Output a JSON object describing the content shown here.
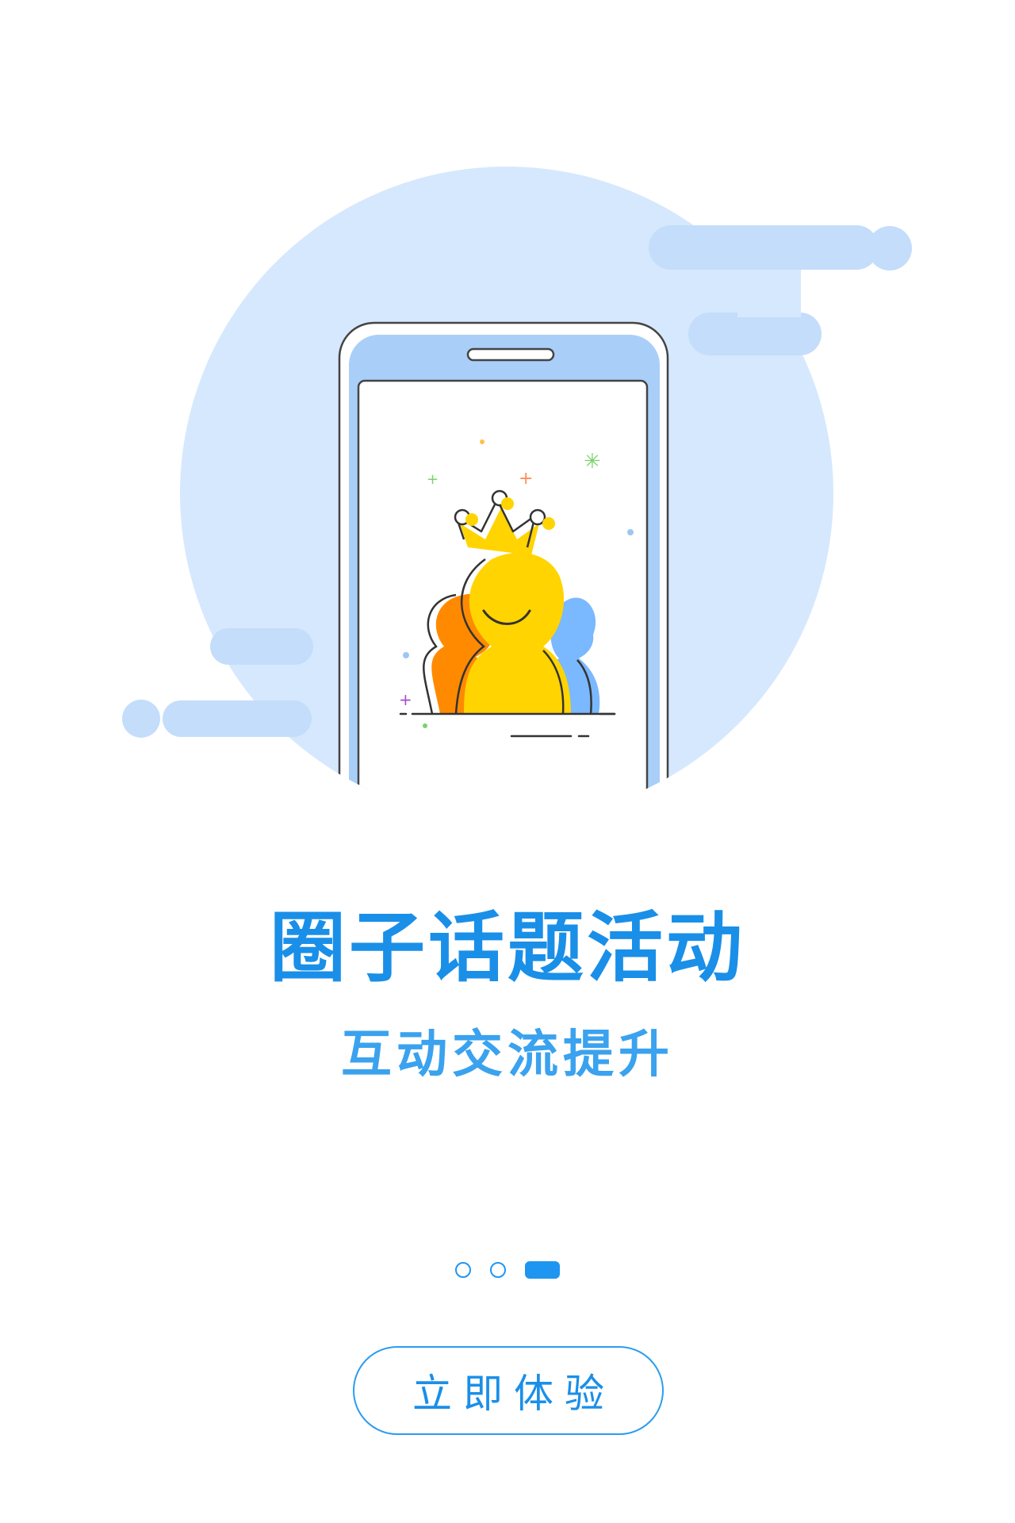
{
  "illustration": {
    "icon": "phone-with-crowned-people-icon"
  },
  "intro": {
    "title": "圈子话题活动",
    "subtitle": "互动交流提升"
  },
  "pager": {
    "total_pages": 3,
    "active_page": 3
  },
  "cta": {
    "label": "立即体验"
  },
  "colors": {
    "accent": "#1a8fe8",
    "circle_bg": "#d6e8fd",
    "cloud": "#c3ddfb",
    "crown_yellow": "#ffd400",
    "left_person_orange": "#ff8a00",
    "right_person_blue": "#7ab8ff"
  }
}
